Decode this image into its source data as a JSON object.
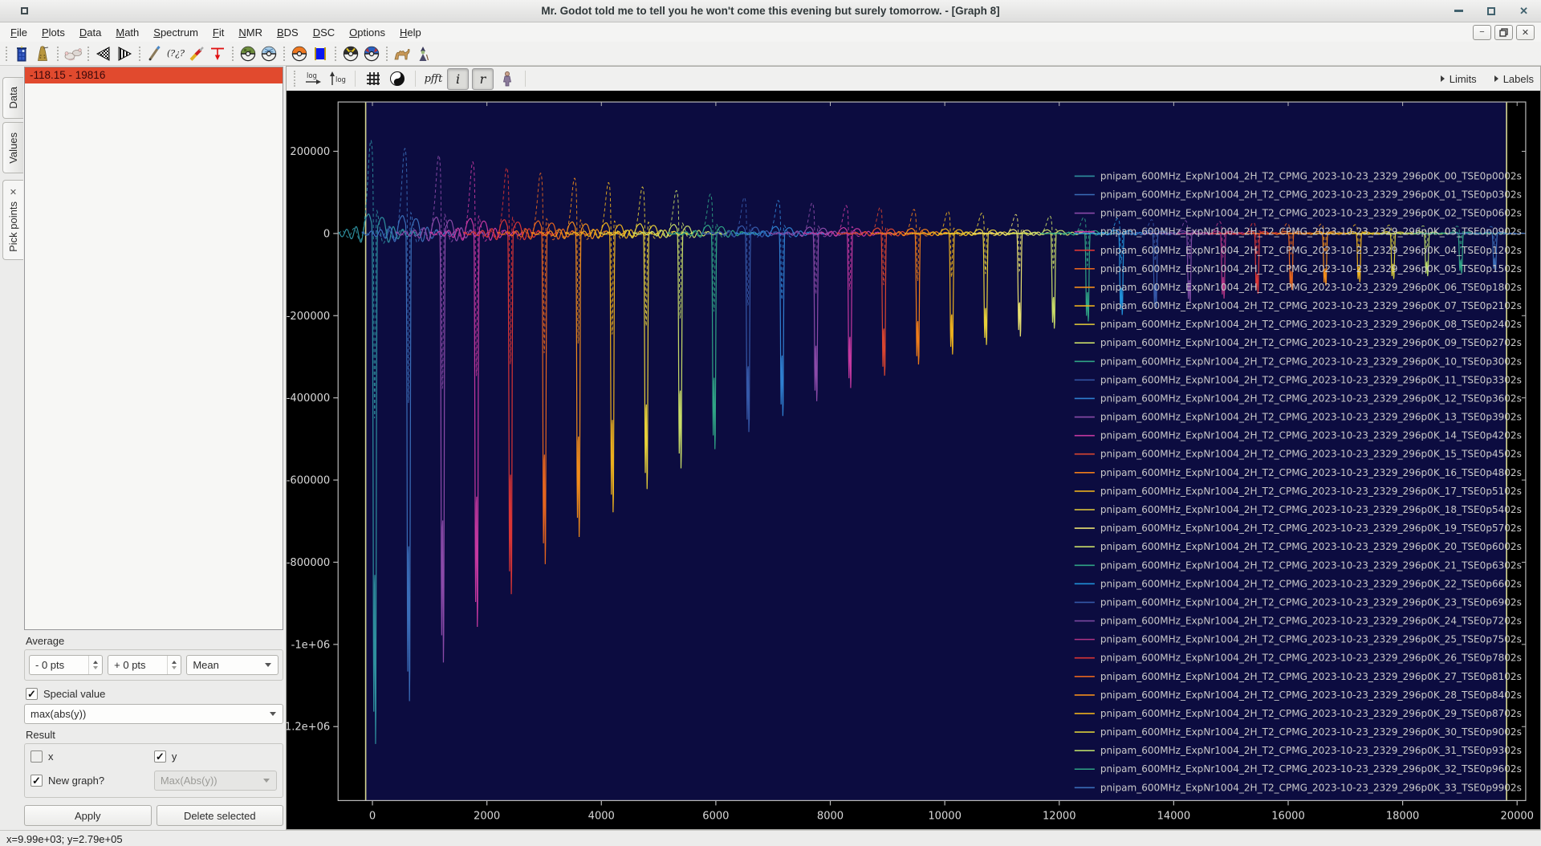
{
  "window": {
    "title": "Mr. Godot told me to tell you he won't come this evening but surely tomorrow. - [Graph 8]"
  },
  "menubar": {
    "items": [
      "File",
      "Plots",
      "Data",
      "Math",
      "Spectrum",
      "Fit",
      "NMR",
      "BDS",
      "DSC",
      "Options",
      "Help"
    ]
  },
  "toolbar": {
    "groups": [
      [
        "tardis",
        "dalek"
      ],
      [
        "mice"
      ],
      [
        "prev-triangle",
        "next-triangle"
      ],
      [
        "pencil",
        "question-marks",
        "screwdriver",
        "baseline-tool"
      ],
      [
        "safari-ball",
        "net-ball"
      ],
      [
        "poke-ball",
        "blue-square"
      ],
      [
        "ultra-ball",
        "great-ball"
      ],
      [
        "camel",
        "wizard"
      ]
    ]
  },
  "mdi_controls": [
    "minimize",
    "restore",
    "close"
  ],
  "sidebar": {
    "tabs": [
      {
        "id": "data",
        "label": "Data",
        "closable": false,
        "active": false
      },
      {
        "id": "values",
        "label": "Values",
        "closable": false,
        "active": false
      },
      {
        "id": "pick-points",
        "label": "Pick points",
        "closable": true,
        "active": true
      }
    ]
  },
  "pick_panel": {
    "list": [
      {
        "text": "-118.15 - 19816",
        "selected": true
      }
    ],
    "average": {
      "title": "Average",
      "minus_spin": "- 0 pts",
      "plus_spin": "+ 0 pts",
      "method": "Mean"
    },
    "special": {
      "label": "Special value",
      "checked": true,
      "value": "max(abs(y))"
    },
    "result": {
      "title": "Result",
      "x_label": "x",
      "x_checked": false,
      "y_label": "y",
      "y_checked": true,
      "new_graph_label": "New graph?",
      "new_graph_checked": true,
      "name_value": "Max(Abs(y))"
    },
    "buttons": {
      "apply": "Apply",
      "delete": "Delete selected"
    }
  },
  "plot_toolbar": {
    "icons": [
      "log-x",
      "log-y",
      "grid",
      "yin-yang",
      "pfft",
      "imag-toggle",
      "real-toggle",
      "figure"
    ],
    "logx_label": "log",
    "logy_label": "log",
    "pfft_label": "pfft",
    "i_label": "i",
    "r_label": "r",
    "limits_label": "Limits",
    "labels_label": "Labels"
  },
  "statusbar": {
    "coords": "x=9.99e+03; y=2.79e+05"
  },
  "chart_data": {
    "type": "line",
    "title": "",
    "xlabel": "",
    "ylabel": "",
    "xlim": [
      -600,
      20150
    ],
    "ylim": [
      -1380000,
      320000
    ],
    "x_ticks": [
      0,
      2000,
      4000,
      6000,
      8000,
      10000,
      12000,
      14000,
      16000,
      18000,
      20000
    ],
    "y_ticks": [
      {
        "v": 200000,
        "label": "200000"
      },
      {
        "v": 0,
        "label": "0"
      },
      {
        "v": -200000,
        "label": "-200000"
      },
      {
        "v": -400000,
        "label": "-400000"
      },
      {
        "v": -600000,
        "label": "-600000"
      },
      {
        "v": -800000,
        "label": "-800000"
      },
      {
        "v": -1000000,
        "label": "-1e+06"
      },
      {
        "v": -1200000,
        "label": "-1.2e+06"
      }
    ],
    "grid": false,
    "legend_position": "right",
    "plot_bg": "#000000",
    "selection": {
      "from": -118.15,
      "to": 19816,
      "fill": "#0c0c40",
      "edge": "#d6d692"
    },
    "frame_color": "#b8b8b8",
    "tick_label_color": "#d8d8d8",
    "legend_text_color": "#c9c9c9",
    "series": [
      {
        "label": "pnipam_600MHz_ExpNr1004_2H_T2_CPMG_2023-10-23_2329_296p0K_00_TSE0p0002s",
        "color": "#2e8f9e",
        "echo_x": 40,
        "peak": -1278000,
        "imag_peak": 256000
      },
      {
        "label": "pnipam_600MHz_ExpNr1004_2H_T2_CPMG_2023-10-23_2329_296p0K_01_TSE0p0302s",
        "color": "#3a6db8",
        "echo_x": 633,
        "peak": -1171000,
        "imag_peak": 234000
      },
      {
        "label": "pnipam_600MHz_ExpNr1004_2H_T2_CPMG_2023-10-23_2329_296p0K_02_TSE0p0602s",
        "color": "#8a4aa8",
        "echo_x": 1226,
        "peak": -1074000,
        "imag_peak": 215000
      },
      {
        "label": "pnipam_600MHz_ExpNr1004_2H_T2_CPMG_2023-10-23_2329_296p0K_03_TSE0p0902s",
        "color": "#c438a0",
        "echo_x": 1819,
        "peak": -985000,
        "imag_peak": 197000
      },
      {
        "label": "pnipam_600MHz_ExpNr1004_2H_T2_CPMG_2023-10-23_2329_296p0K_04_TSE0p1202s",
        "color": "#d93535",
        "echo_x": 2412,
        "peak": -903000,
        "imag_peak": 181000
      },
      {
        "label": "pnipam_600MHz_ExpNr1004_2H_T2_CPMG_2023-10-23_2329_296p0K_05_TSE0p1502s",
        "color": "#e3641f",
        "echo_x": 3005,
        "peak": -828000,
        "imag_peak": 166000
      },
      {
        "label": "pnipam_600MHz_ExpNr1004_2H_T2_CPMG_2023-10-23_2329_296p0K_06_TSE0p1802s",
        "color": "#f08c1c",
        "echo_x": 3598,
        "peak": -760000,
        "imag_peak": 152000
      },
      {
        "label": "pnipam_600MHz_ExpNr1004_2H_T2_CPMG_2023-10-23_2329_296p0K_07_TSE0p2102s",
        "color": "#eaaf1e",
        "echo_x": 4191,
        "peak": -698000,
        "imag_peak": 140000
      },
      {
        "label": "pnipam_600MHz_ExpNr1004_2H_T2_CPMG_2023-10-23_2329_296p0K_08_TSE0p2402s",
        "color": "#e6cf3a",
        "echo_x": 4784,
        "peak": -640000,
        "imag_peak": 128000
      },
      {
        "label": "pnipam_600MHz_ExpNr1004_2H_T2_CPMG_2023-10-23_2329_296p0K_09_TSE0p2702s",
        "color": "#c8dc68",
        "echo_x": 5377,
        "peak": -588000,
        "imag_peak": 118000
      },
      {
        "label": "pnipam_600MHz_ExpNr1004_2H_T2_CPMG_2023-10-23_2329_296p0K_10_TSE0p3002s",
        "color": "#2fa385",
        "echo_x": 5970,
        "peak": -540000,
        "imag_peak": 108000
      },
      {
        "label": "pnipam_600MHz_ExpNr1004_2H_T2_CPMG_2023-10-23_2329_296p0K_11_TSE0p3302s",
        "color": "#3558a8",
        "echo_x": 6563,
        "peak": -497000,
        "imag_peak": 99000
      },
      {
        "label": "pnipam_600MHz_ExpNr1004_2H_T2_CPMG_2023-10-23_2329_296p0K_12_TSE0p3602s",
        "color": "#2f7fd0",
        "echo_x": 7156,
        "peak": -457000,
        "imag_peak": 91000
      },
      {
        "label": "pnipam_600MHz_ExpNr1004_2H_T2_CPMG_2023-10-23_2329_296p0K_13_TSE0p3902s",
        "color": "#8a4aa8",
        "echo_x": 7749,
        "peak": -420000,
        "imag_peak": 84000
      },
      {
        "label": "pnipam_600MHz_ExpNr1004_2H_T2_CPMG_2023-10-23_2329_296p0K_14_TSE0p4202s",
        "color": "#c438a0",
        "echo_x": 8342,
        "peak": -387000,
        "imag_peak": 77000
      },
      {
        "label": "pnipam_600MHz_ExpNr1004_2H_T2_CPMG_2023-10-23_2329_296p0K_15_TSE0p4502s",
        "color": "#d94530",
        "echo_x": 8935,
        "peak": -356000,
        "imag_peak": 71000
      },
      {
        "label": "pnipam_600MHz_ExpNr1004_2H_T2_CPMG_2023-10-23_2329_296p0K_16_TSE0p4802s",
        "color": "#ee7c1a",
        "echo_x": 9528,
        "peak": -328000,
        "imag_peak": 66000
      },
      {
        "label": "pnipam_600MHz_ExpNr1004_2H_T2_CPMG_2023-10-23_2329_296p0K_17_TSE0p5102s",
        "color": "#eaaf1e",
        "echo_x": 10121,
        "peak": -303000,
        "imag_peak": 61000
      },
      {
        "label": "pnipam_600MHz_ExpNr1004_2H_T2_CPMG_2023-10-23_2329_296p0K_18_TSE0p5402s",
        "color": "#e6cf3a",
        "echo_x": 10714,
        "peak": -279000,
        "imag_peak": 56000
      },
      {
        "label": "pnipam_600MHz_ExpNr1004_2H_T2_CPMG_2023-10-23_2329_296p0K_19_TSE0p5702s",
        "color": "#e8e070",
        "echo_x": 11307,
        "peak": -258000,
        "imag_peak": 52000
      },
      {
        "label": "pnipam_600MHz_ExpNr1004_2H_T2_CPMG_2023-10-23_2329_296p0K_20_TSE0p6002s",
        "color": "#c8dc68",
        "echo_x": 11900,
        "peak": -238000,
        "imag_peak": 48000
      },
      {
        "label": "pnipam_600MHz_ExpNr1004_2H_T2_CPMG_2023-10-23_2329_296p0K_21_TSE0p6302s",
        "color": "#2fa385",
        "echo_x": 12493,
        "peak": -220000,
        "imag_peak": 44000
      },
      {
        "label": "pnipam_600MHz_ExpNr1004_2H_T2_CPMG_2023-10-23_2329_296p0K_22_TSE0p6602s",
        "color": "#2090d8",
        "echo_x": 13086,
        "peak": -204000,
        "imag_peak": 41000
      },
      {
        "label": "pnipam_600MHz_ExpNr1004_2H_T2_CPMG_2023-10-23_2329_296p0K_23_TSE0p6902s",
        "color": "#3558a8",
        "echo_x": 13679,
        "peak": -189000,
        "imag_peak": 38000
      },
      {
        "label": "pnipam_600MHz_ExpNr1004_2H_T2_CPMG_2023-10-23_2329_296p0K_24_TSE0p7202s",
        "color": "#7a48a0",
        "echo_x": 14272,
        "peak": -175000,
        "imag_peak": 35000
      },
      {
        "label": "pnipam_600MHz_ExpNr1004_2H_T2_CPMG_2023-10-23_2329_296p0K_25_TSE0p7502s",
        "color": "#b03585",
        "echo_x": 14865,
        "peak": -163000,
        "imag_peak": 33000
      },
      {
        "label": "pnipam_600MHz_ExpNr1004_2H_T2_CPMG_2023-10-23_2329_296p0K_26_TSE0p7802s",
        "color": "#d93535",
        "echo_x": 15458,
        "peak": -151000,
        "imag_peak": 30000
      },
      {
        "label": "pnipam_600MHz_ExpNr1004_2H_T2_CPMG_2023-10-23_2329_296p0K_27_TSE0p8102s",
        "color": "#e3641f",
        "echo_x": 16051,
        "peak": -141000,
        "imag_peak": 28000
      },
      {
        "label": "pnipam_600MHz_ExpNr1004_2H_T2_CPMG_2023-10-23_2329_296p0K_28_TSE0p8402s",
        "color": "#f08c1c",
        "echo_x": 16644,
        "peak": -131000,
        "imag_peak": 26000
      },
      {
        "label": "pnipam_600MHz_ExpNr1004_2H_T2_CPMG_2023-10-23_2329_296p0K_29_TSE0p8702s",
        "color": "#eaaf1e",
        "echo_x": 17237,
        "peak": -122000,
        "imag_peak": 24000
      },
      {
        "label": "pnipam_600MHz_ExpNr1004_2H_T2_CPMG_2023-10-23_2329_296p0K_30_TSE0p9002s",
        "color": "#d8cc3a",
        "echo_x": 17830,
        "peak": -114000,
        "imag_peak": 23000
      },
      {
        "label": "pnipam_600MHz_ExpNr1004_2H_T2_CPMG_2023-10-23_2329_296p0K_31_TSE0p9302s",
        "color": "#b8d868",
        "echo_x": 18423,
        "peak": -107000,
        "imag_peak": 21000
      },
      {
        "label": "pnipam_600MHz_ExpNr1004_2H_T2_CPMG_2023-10-23_2329_296p0K_32_TSE0p9602s",
        "color": "#2fa385",
        "echo_x": 19016,
        "peak": -100000,
        "imag_peak": 20000
      },
      {
        "label": "pnipam_600MHz_ExpNr1004_2H_T2_CPMG_2023-10-23_2329_296p0K_33_TSE0p9902s",
        "color": "#3a6db8",
        "echo_x": 19609,
        "peak": -94000,
        "imag_peak": 19000
      }
    ]
  }
}
